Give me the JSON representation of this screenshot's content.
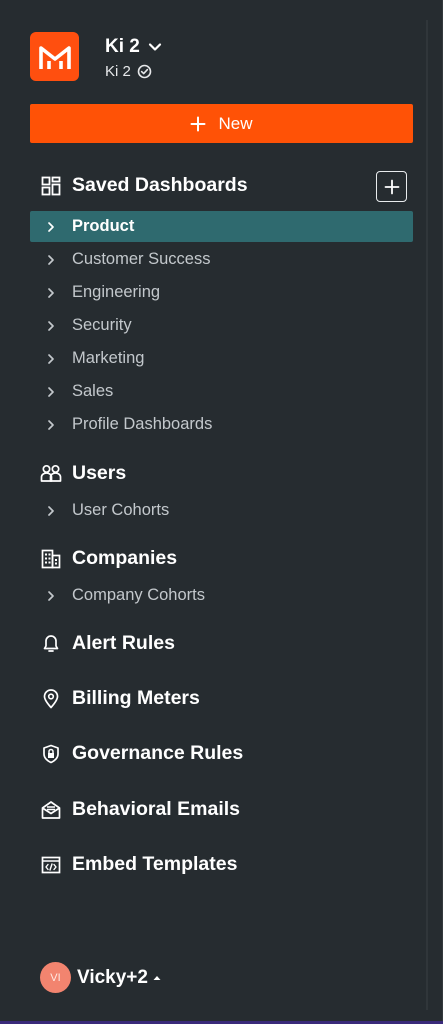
{
  "workspace": {
    "name": "Ki 2",
    "subtitle": "Ki 2"
  },
  "new_button": {
    "label": "New"
  },
  "sections": {
    "saved_dashboards": {
      "label": "Saved Dashboards",
      "items": [
        {
          "label": "Product",
          "active": true
        },
        {
          "label": "Customer Success"
        },
        {
          "label": "Engineering"
        },
        {
          "label": "Security"
        },
        {
          "label": "Marketing"
        },
        {
          "label": "Sales"
        },
        {
          "label": "Profile Dashboards"
        }
      ]
    },
    "users": {
      "label": "Users",
      "items": [
        {
          "label": "User Cohorts"
        }
      ]
    },
    "companies": {
      "label": "Companies",
      "items": [
        {
          "label": "Company Cohorts"
        }
      ]
    },
    "alert_rules": {
      "label": "Alert Rules"
    },
    "billing_meters": {
      "label": "Billing Meters"
    },
    "governance_rules": {
      "label": "Governance Rules"
    },
    "behavioral_emails": {
      "label": "Behavioral Emails"
    },
    "embed_templates": {
      "label": "Embed Templates"
    }
  },
  "user": {
    "initials": "VI",
    "name": "Vicky+2"
  },
  "colors": {
    "background": "#262c30",
    "accent": "#ff5206",
    "active_item": "#2f6a6f",
    "avatar": "#f2846f"
  },
  "icons": {
    "logo": "mixpanel-logo-icon",
    "saved_dashboards": "dashboard-grid-icon",
    "users": "users-group-icon",
    "companies": "building-icon",
    "alert_rules": "bell-icon",
    "billing_meters": "location-pin-icon",
    "governance_rules": "shield-lock-icon",
    "behavioral_emails": "envelope-icon",
    "embed_templates": "code-window-icon"
  }
}
